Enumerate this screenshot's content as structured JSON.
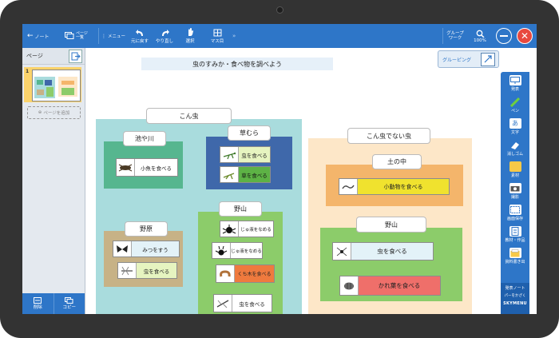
{
  "toolbar": {
    "note": "ノート",
    "page_list": "ページ\n一覧",
    "menu": "メニュー",
    "undo": "元に戻す",
    "redo": "やり直し",
    "select": "選択",
    "masu": "マス目",
    "group_work": "グループ\nワーク",
    "zoom": "100%",
    "accent": "#2e76c8"
  },
  "left_panel": {
    "title": "ページ",
    "page_number": "1",
    "add_page": "ページを追加",
    "delete": "削除",
    "copy": "コピー"
  },
  "canvas": {
    "title": "虫のすみか・食べ物を調べよう",
    "grouping": "グルーピング",
    "groups": {
      "konchu": {
        "label": "こん虫",
        "subgroups": {
          "ikegawa": {
            "label": "池や川",
            "cards": [
              {
                "text": "小魚を食べる",
                "icon": "water-bug-icon"
              }
            ]
          },
          "kusamura": {
            "label": "草むら",
            "cards": [
              {
                "text": "虫を食べる",
                "icon": "mantis-icon"
              },
              {
                "text": "草を食べる",
                "icon": "grasshopper-icon"
              }
            ]
          },
          "nohara": {
            "label": "野原",
            "cards": [
              {
                "text": "みつをすう",
                "icon": "butterfly-icon"
              },
              {
                "text": "虫を食べる",
                "icon": "dragonfly-icon"
              }
            ]
          },
          "yama": {
            "label": "野山",
            "cards": [
              {
                "text": "じゅ液をなめる",
                "icon": "beetle-icon"
              },
              {
                "text": "じゅ液をなめる",
                "icon": "stag-beetle-icon"
              },
              {
                "text": "くち木を食べる",
                "icon": "larva-icon"
              },
              {
                "text": "虫を食べる",
                "icon": "dragonfly-icon"
              }
            ]
          }
        }
      },
      "not_konchu": {
        "label": "こん虫でない虫",
        "subgroups": {
          "tsuchi": {
            "label": "土の中",
            "cards": [
              {
                "text": "小動物を食べる",
                "icon": "earthworm-icon"
              }
            ]
          },
          "yama": {
            "label": "野山",
            "cards": [
              {
                "text": "虫を食べる",
                "icon": "spider-icon"
              },
              {
                "text": "かれ葉を食べる",
                "icon": "pillbug-icon"
              }
            ]
          }
        }
      }
    }
  },
  "right_toolbar": {
    "items": [
      "発表",
      "ペン",
      "文字",
      "消しゴム",
      "素材",
      "撮影",
      "画面保存",
      "教材・作品",
      "資料書き出"
    ],
    "footer_1": "発表ノート",
    "footer_2": "パーをかざく",
    "brand": "SKYMENU"
  }
}
